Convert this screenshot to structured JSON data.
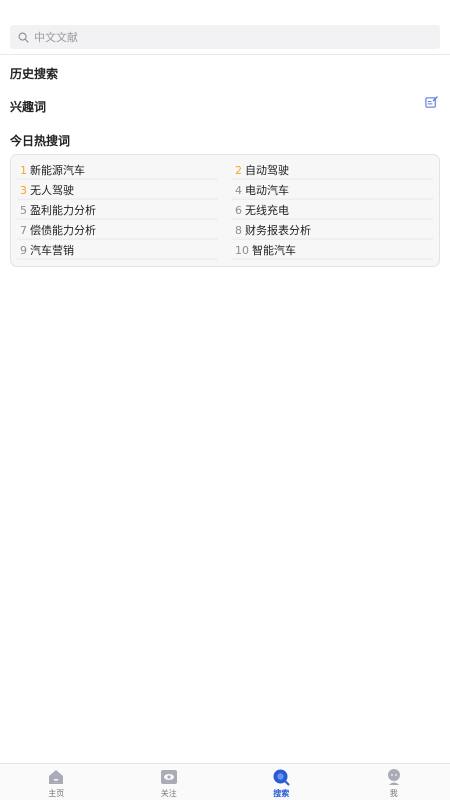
{
  "search": {
    "placeholder": "中文文献"
  },
  "sections": {
    "history": "历史搜索",
    "interest": "兴趣词",
    "hot_today": "今日热搜词"
  },
  "hot_words": [
    {
      "rank": "1",
      "text": "新能源汽车"
    },
    {
      "rank": "2",
      "text": "自动驾驶"
    },
    {
      "rank": "3",
      "text": "无人驾驶"
    },
    {
      "rank": "4",
      "text": "电动汽车"
    },
    {
      "rank": "5",
      "text": "盈利能力分析"
    },
    {
      "rank": "6",
      "text": "无线充电"
    },
    {
      "rank": "7",
      "text": "偿债能力分析"
    },
    {
      "rank": "8",
      "text": "财务报表分析"
    },
    {
      "rank": "9",
      "text": "汽车营销"
    },
    {
      "rank": "10",
      "text": "智能汽车"
    }
  ],
  "tabs": [
    {
      "label": "主页",
      "icon": "home-icon",
      "active": false
    },
    {
      "label": "关注",
      "icon": "follow-eye-icon",
      "active": false
    },
    {
      "label": "搜索",
      "icon": "search-tab-icon",
      "active": true
    },
    {
      "label": "我",
      "icon": "profile-icon",
      "active": false
    }
  ],
  "colors": {
    "accent": "#2a5bd7",
    "top_rank": "#f5a623",
    "rank": "#8d8d92"
  }
}
